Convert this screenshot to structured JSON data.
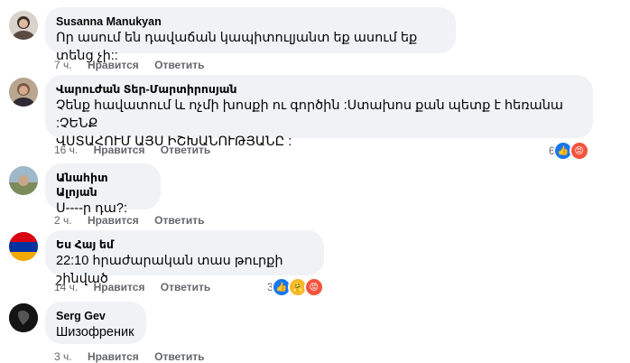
{
  "labels": {
    "like": "Нравится",
    "reply": "Ответить"
  },
  "comments": [
    {
      "author": "Susanna Manukyan",
      "text": "Որ ասում են դավաճան կապիտուլյանտ եք ասում եք տենց չի::",
      "time": "7 ч."
    },
    {
      "author": "Վարուժան Տեր-Մարտիրոսյան",
      "text": "Չենք հավատում և ոչմի խոսքի ու գործին :Ստախոս քան պետք է հեռանա :ՉԵՆՔ\nՎՍՏԱՀՈՒՄ ԱՅՍ ԻՇԽԱՆՈՒԹՅԱՆԸ :",
      "time": "16 ч.",
      "reactions": {
        "count": "6",
        "icons": [
          "like-icon",
          "angry-icon"
        ]
      }
    },
    {
      "author": "Անահիտ Ալոյան",
      "text": "Ս----ր դա?:",
      "time": "2 ч."
    },
    {
      "author": "Ես Հայ եմ",
      "text": "22:10 հրաժարական տաս թուրքի շինված",
      "time": "14 ч.",
      "reactions": {
        "count": "3",
        "icons": [
          "like-icon",
          "care-icon",
          "angry-icon"
        ]
      }
    },
    {
      "author": "Serg Gev",
      "text": "Шизофреник",
      "time": "3 ч."
    }
  ]
}
